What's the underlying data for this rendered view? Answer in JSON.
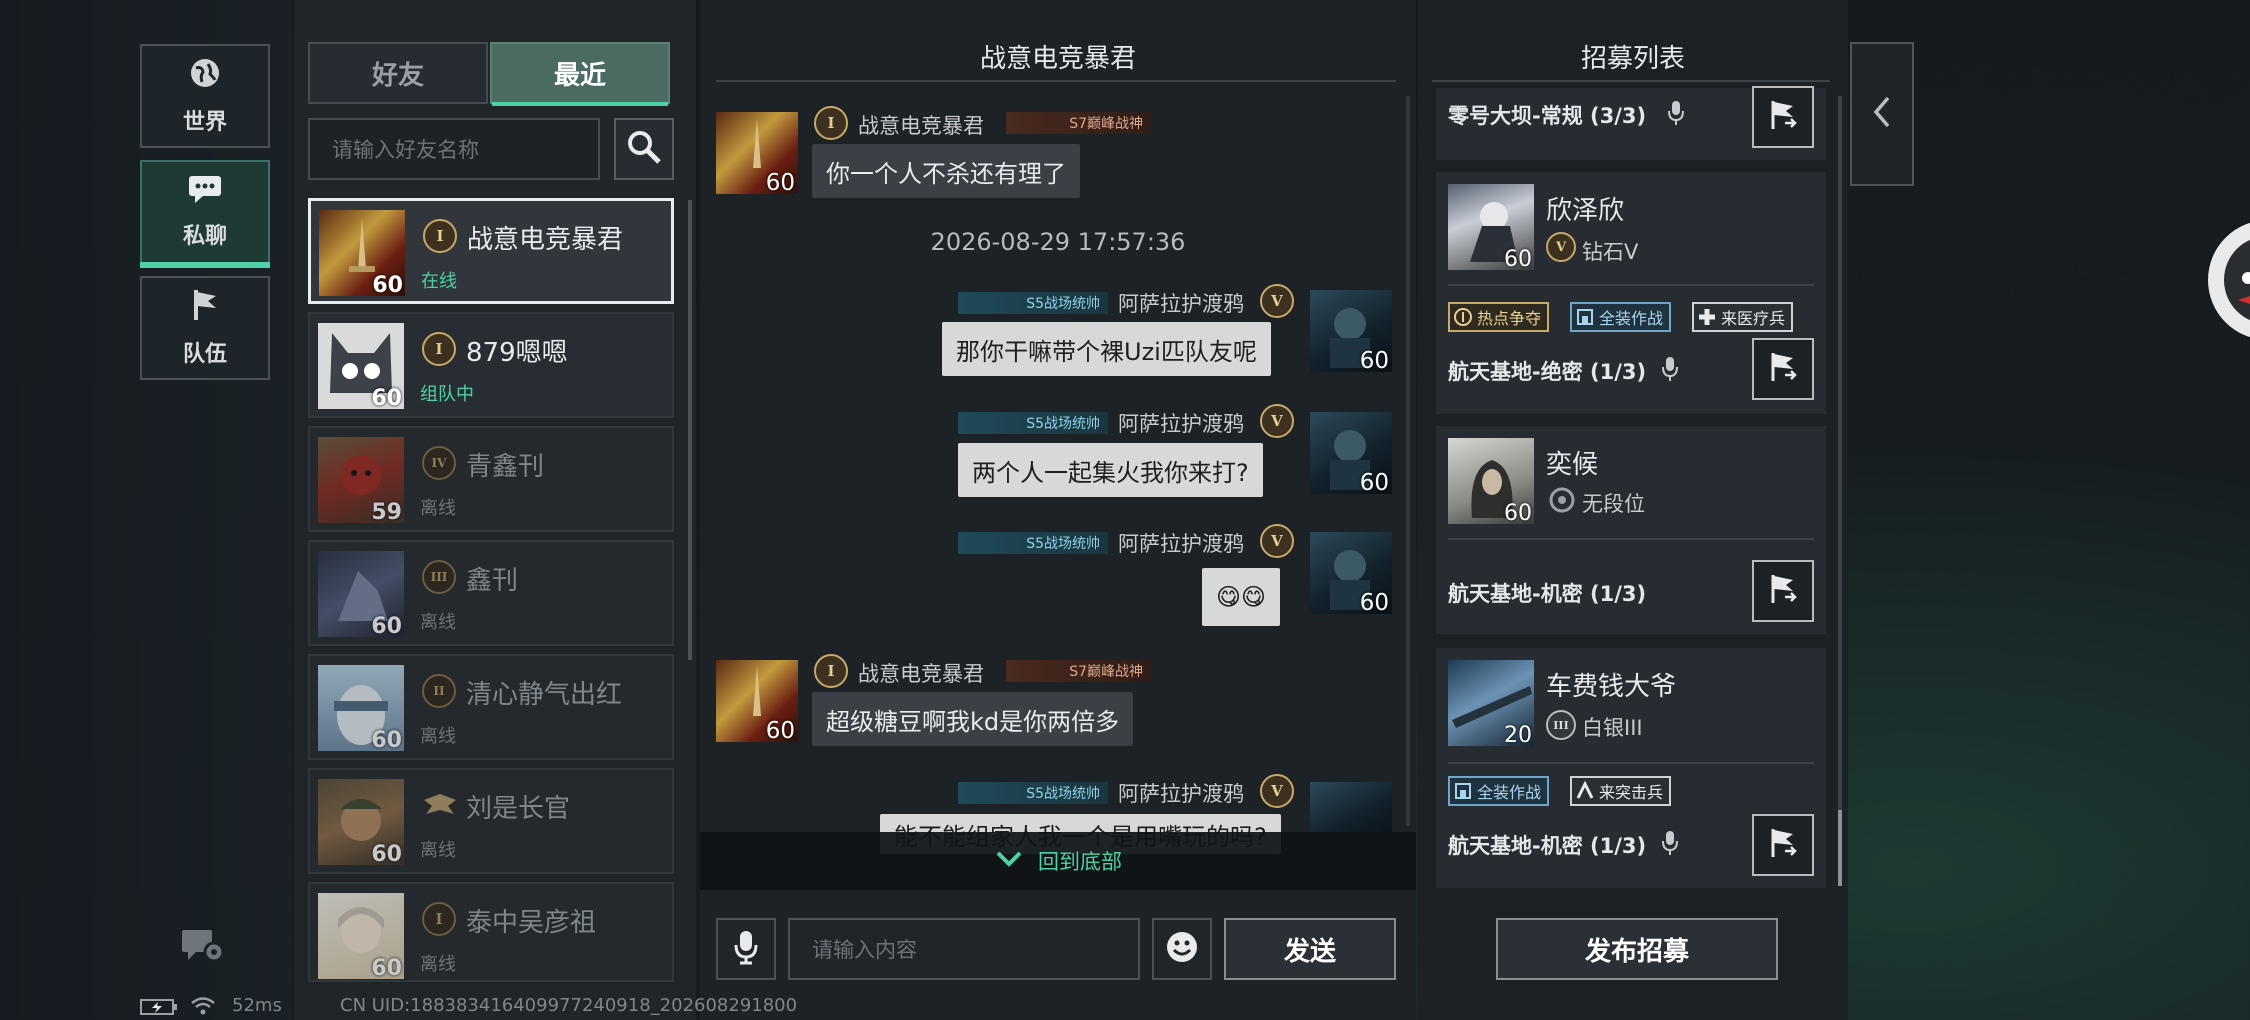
{
  "nav": {
    "world_label": "世界",
    "private_label": "私聊",
    "team_label": "队伍"
  },
  "friends": {
    "tab_friends": "好友",
    "tab_recent": "最近",
    "search_placeholder": "请输入好友名称",
    "items": [
      {
        "name": "战意电竞暴君",
        "status": "在线",
        "status_color": "#4fd1a8",
        "rank": "I",
        "level": "60"
      },
      {
        "name": "879嗯嗯",
        "status": "组队中",
        "status_color": "#4fd1a8",
        "rank": "I",
        "level": "60"
      },
      {
        "name": "青鑫刊",
        "status": "离线",
        "status_color": "#6c7378",
        "rank": "IV",
        "level": "59"
      },
      {
        "name": "鑫刊",
        "status": "离线",
        "status_color": "#6c7378",
        "rank": "III",
        "level": "60"
      },
      {
        "name": "清心静气出红",
        "status": "离线",
        "status_color": "#6c7378",
        "rank": "II",
        "level": "60"
      },
      {
        "name": "刘是长官",
        "status": "离线",
        "status_color": "#6c7378",
        "rank": "wings",
        "level": "60"
      },
      {
        "name": "泰中吴彦祖",
        "status": "离线",
        "status_color": "#6c7378",
        "rank": "I",
        "level": "60"
      }
    ]
  },
  "chat": {
    "title": "战意电竞暴君",
    "timestamp": "2026-08-29 17:57:36",
    "sender_a": {
      "name": "战意电竞暴君",
      "title_badge": "S7巅峰战神",
      "level": "60",
      "rank": "I"
    },
    "sender_b": {
      "name": "阿萨拉护渡鸦",
      "title_badge": "S5战场统帅",
      "level": "60",
      "rank": "V"
    },
    "messages": [
      {
        "text": "你一个人不杀还有理了"
      },
      {
        "text": "那你干嘛带个裸Uzi匹队友呢"
      },
      {
        "text": "两个人一起集火我你来打?"
      },
      {
        "text": "😋😋"
      },
      {
        "text": "超级糖豆啊我kd是你两倍多"
      },
      {
        "text": "能不能组家人我一个是用嘴玩的吗?"
      }
    ],
    "back_to_bottom": "回到底部",
    "input_placeholder": "请输入内容",
    "send_label": "发送"
  },
  "recruit": {
    "title": "招募列表",
    "publish_label": "发布招募",
    "top_card_title": "零号大坝-常规 (3/3)",
    "cards": [
      {
        "name": "欣泽欣",
        "rank": "钻石V",
        "level": "60",
        "tags": [
          "热点争夺",
          "全装作战",
          "来医疗兵"
        ],
        "title": "航天基地-绝密 (1/3)"
      },
      {
        "name": "奕候",
        "rank": "无段位",
        "level": "60",
        "tags": [],
        "title": "航天基地-机密 (1/3)"
      },
      {
        "name": "车费钱大爷",
        "rank": "白银III",
        "level": "20",
        "tags": [
          "全装作战",
          "来突击兵"
        ],
        "title": "航天基地-机密 (1/3)"
      }
    ]
  },
  "footer": {
    "ping": "52ms",
    "uid": "CN UID:188383416409977240918_202608291800"
  },
  "colors": {
    "accent": "#4fd1a8",
    "bubble": "#d7d9d9"
  }
}
